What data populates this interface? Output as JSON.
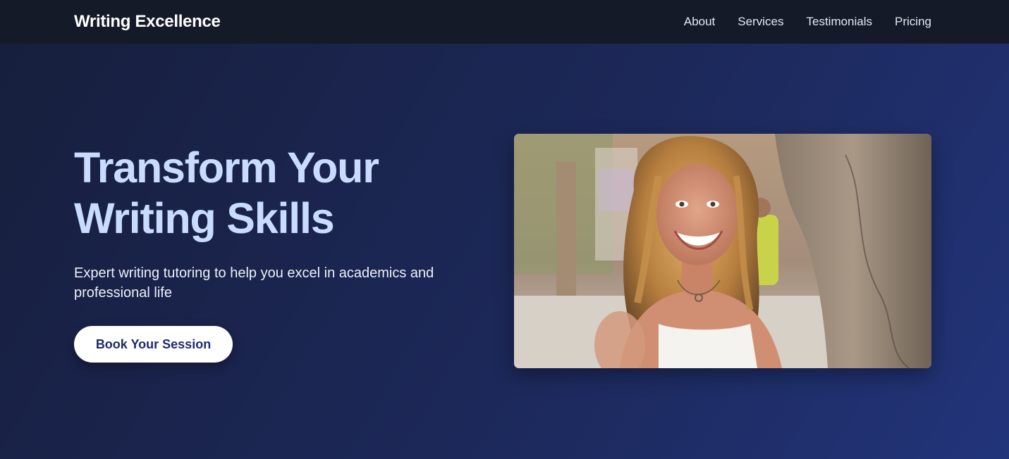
{
  "header": {
    "brand": "Writing Excellence",
    "nav": [
      {
        "label": "About"
      },
      {
        "label": "Services"
      },
      {
        "label": "Testimonials"
      },
      {
        "label": "Pricing"
      }
    ]
  },
  "hero": {
    "title_line1": "Transform Your",
    "title_line2": "Writing Skills",
    "subtitle": "Expert writing tutoring to help you excel in academics and professional life",
    "cta_label": "Book Your Session"
  },
  "colors": {
    "nav_bg": "#141a28",
    "hero_bg_start": "#171f3d",
    "hero_bg_end": "#22347a",
    "title_color": "#c9dcff",
    "cta_text": "#1d2b6b"
  }
}
